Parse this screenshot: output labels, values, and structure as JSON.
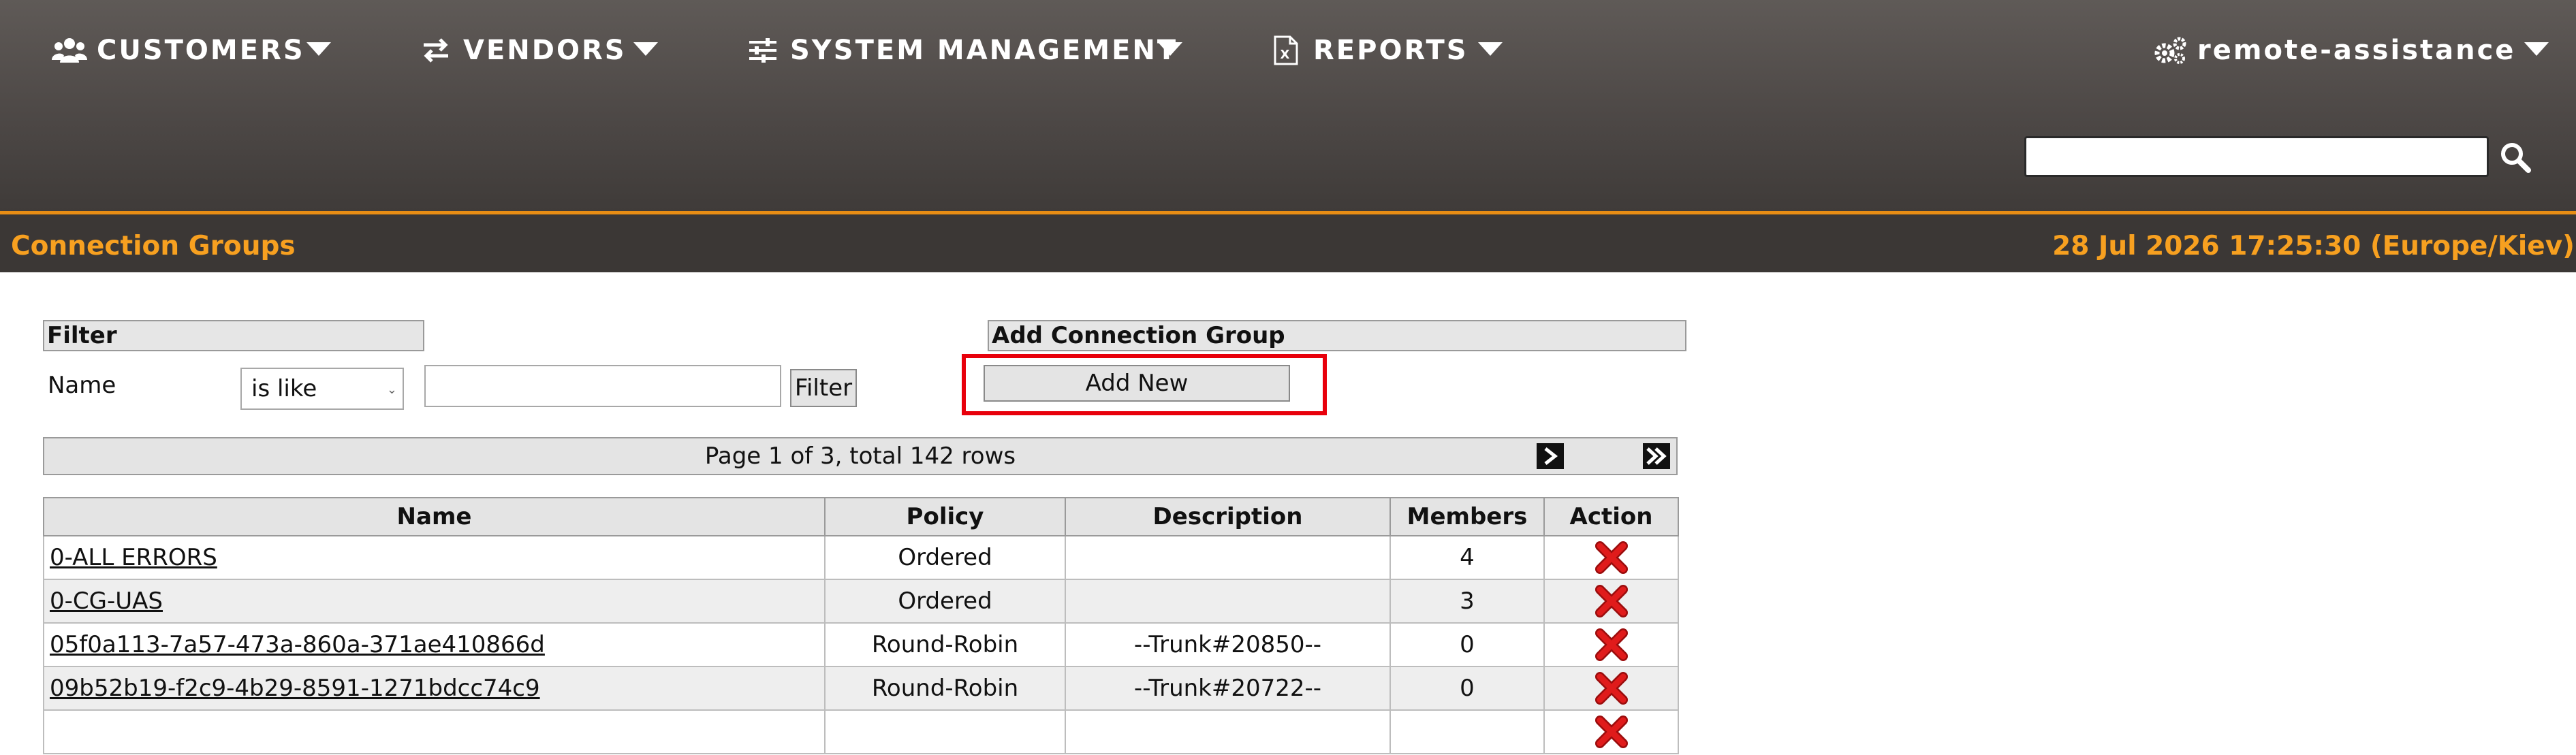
{
  "nav": {
    "customers": "CUSTOMERS",
    "vendors": "VENDORS",
    "system_management": "SYSTEM MANAGEMENT",
    "reports": "REPORTS",
    "user": "remote-assistance"
  },
  "search": {
    "value": "",
    "placeholder": ""
  },
  "page": {
    "title": "Connection Groups",
    "datetime": "28 Jul 2026 17:25:30 (Europe/Kiev)"
  },
  "filter": {
    "header": "Filter",
    "name_label": "Name",
    "operator": "is like",
    "value": "",
    "button": "Filter"
  },
  "add_group": {
    "header": "Add Connection Group",
    "button": "Add New"
  },
  "pager": {
    "text": "Page 1 of 3, total 142 rows"
  },
  "table": {
    "columns": [
      "Name",
      "Policy",
      "Description",
      "Members",
      "Action"
    ],
    "rows": [
      {
        "name": "0-ALL ERRORS",
        "policy": "Ordered",
        "description": "",
        "members": "4"
      },
      {
        "name": "0-CG-UAS",
        "policy": "Ordered",
        "description": "",
        "members": "3"
      },
      {
        "name": "05f0a113-7a57-473a-860a-371ae410866d",
        "policy": "Round-Robin",
        "description": "--Trunk#20850--",
        "members": "0"
      },
      {
        "name": "09b52b19-f2c9-4b29-8591-1271bdcc74c9",
        "policy": "Round-Robin",
        "description": "--Trunk#20722--",
        "members": "0"
      },
      {
        "name": "",
        "policy": "",
        "description": "",
        "members": ""
      }
    ]
  },
  "colors": {
    "accent_orange": "#f7a020",
    "topbar": "#4d4846",
    "delete_red": "#e01b1b",
    "highlight_red": "#e8000b"
  },
  "icons": [
    "users-icon",
    "arrows-exchange-icon",
    "sliders-icon",
    "excel-file-icon",
    "gears-icon",
    "search-icon",
    "chevron-right-icon",
    "double-chevron-right-icon",
    "delete-x-icon"
  ]
}
